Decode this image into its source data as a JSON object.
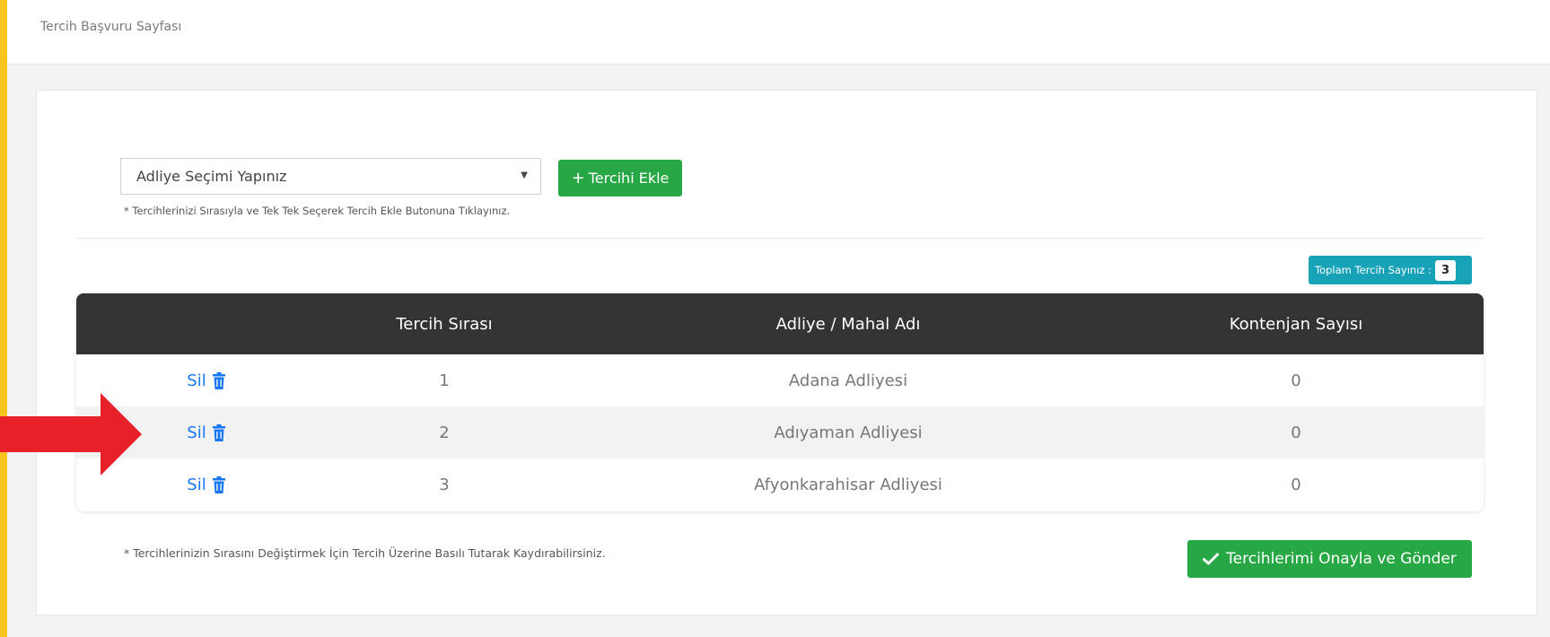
{
  "breadcrumb": "Tercih Başvuru Sayfası",
  "form": {
    "select_value": "Adliye Seçimi Yapınız",
    "add_button_label": "Tercihi Ekle",
    "hint_top": "* Tercihlerinizi Sırasıyla ve Tek Tek Seçerek Tercih Ekle Butonuna Tıklayınız."
  },
  "summary": {
    "label": "Toplam Tercih Sayınız :",
    "count": "3"
  },
  "table": {
    "headers": [
      "",
      "Tercih Sırası",
      "Adliye / Mahal Adı",
      "Kontenjan Sayısı"
    ],
    "delete_label": "Sil",
    "rows": [
      {
        "order": "1",
        "name": "Adana Adliyesi",
        "quota": "0"
      },
      {
        "order": "2",
        "name": "Adıyaman Adliyesi",
        "quota": "0"
      },
      {
        "order": "3",
        "name": "Afyonkarahisar Adliyesi",
        "quota": "0"
      }
    ]
  },
  "footer": {
    "hint_bottom": "* Tercihlerinizin Sırasını Değiştirmek İçin Tercih Üzerine Basılı Tutarak Kaydırabilirsiniz.",
    "submit_label": "Tercihlerimi Onayla ve Gönder"
  },
  "icons": {
    "delete": "trash-icon",
    "submit": "check-icon",
    "add": "plus-icon",
    "dropdown": "caret-down-icon",
    "annotation": "red-arrow-icon"
  },
  "colors": {
    "accent_stripe": "#f7c51e",
    "success": "#28a745",
    "info": "#17a2b8",
    "link": "#1877f2",
    "table_header": "#333333",
    "annotation_arrow": "#e8202a"
  }
}
